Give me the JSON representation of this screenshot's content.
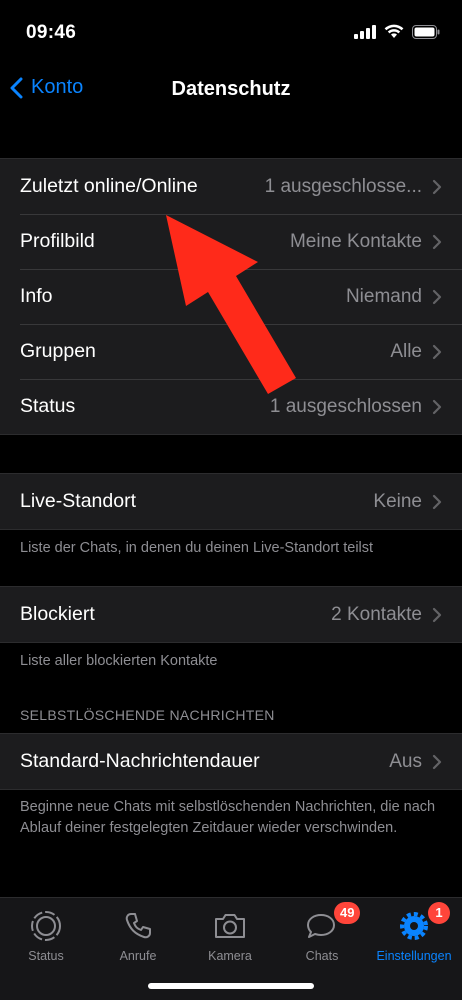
{
  "status_bar": {
    "time": "09:46"
  },
  "nav": {
    "back_label": "Konto",
    "title": "Datenschutz"
  },
  "privacy_rows": [
    {
      "label": "Zuletzt online/Online",
      "value": "1 ausgeschlosse..."
    },
    {
      "label": "Profilbild",
      "value": "Meine Kontakte"
    },
    {
      "label": "Info",
      "value": "Niemand"
    },
    {
      "label": "Gruppen",
      "value": "Alle"
    },
    {
      "label": "Status",
      "value": "1 ausgeschlossen"
    }
  ],
  "live_location": {
    "label": "Live-Standort",
    "value": "Keine",
    "footnote": "Liste der Chats, in denen du deinen Live-Standort teilst"
  },
  "blocked": {
    "label": "Blockiert",
    "value": "2 Kontakte",
    "footnote": "Liste aller blockierten Kontakte"
  },
  "disappearing": {
    "section_header": "SELBSTLÖSCHENDE NACHRICHTEN",
    "label": "Standard-Nachrichtendauer",
    "value": "Aus",
    "footnote": "Beginne neue Chats mit selbstlöschenden Nachrichten, die nach Ablauf deiner festgelegten Zeitdauer wieder verschwinden."
  },
  "tab_bar": {
    "tabs": [
      {
        "label": "Status",
        "icon": "status-ring-icon"
      },
      {
        "label": "Anrufe",
        "icon": "phone-icon"
      },
      {
        "label": "Kamera",
        "icon": "camera-icon"
      },
      {
        "label": "Chats",
        "icon": "chat-bubbles-icon",
        "badge": "49"
      },
      {
        "label": "Einstellungen",
        "icon": "gear-icon",
        "badge": "1",
        "active": true
      }
    ]
  },
  "colors": {
    "accent": "#0a84ff",
    "badge": "#ff453a",
    "annotation_arrow": "#ff2a1a"
  }
}
